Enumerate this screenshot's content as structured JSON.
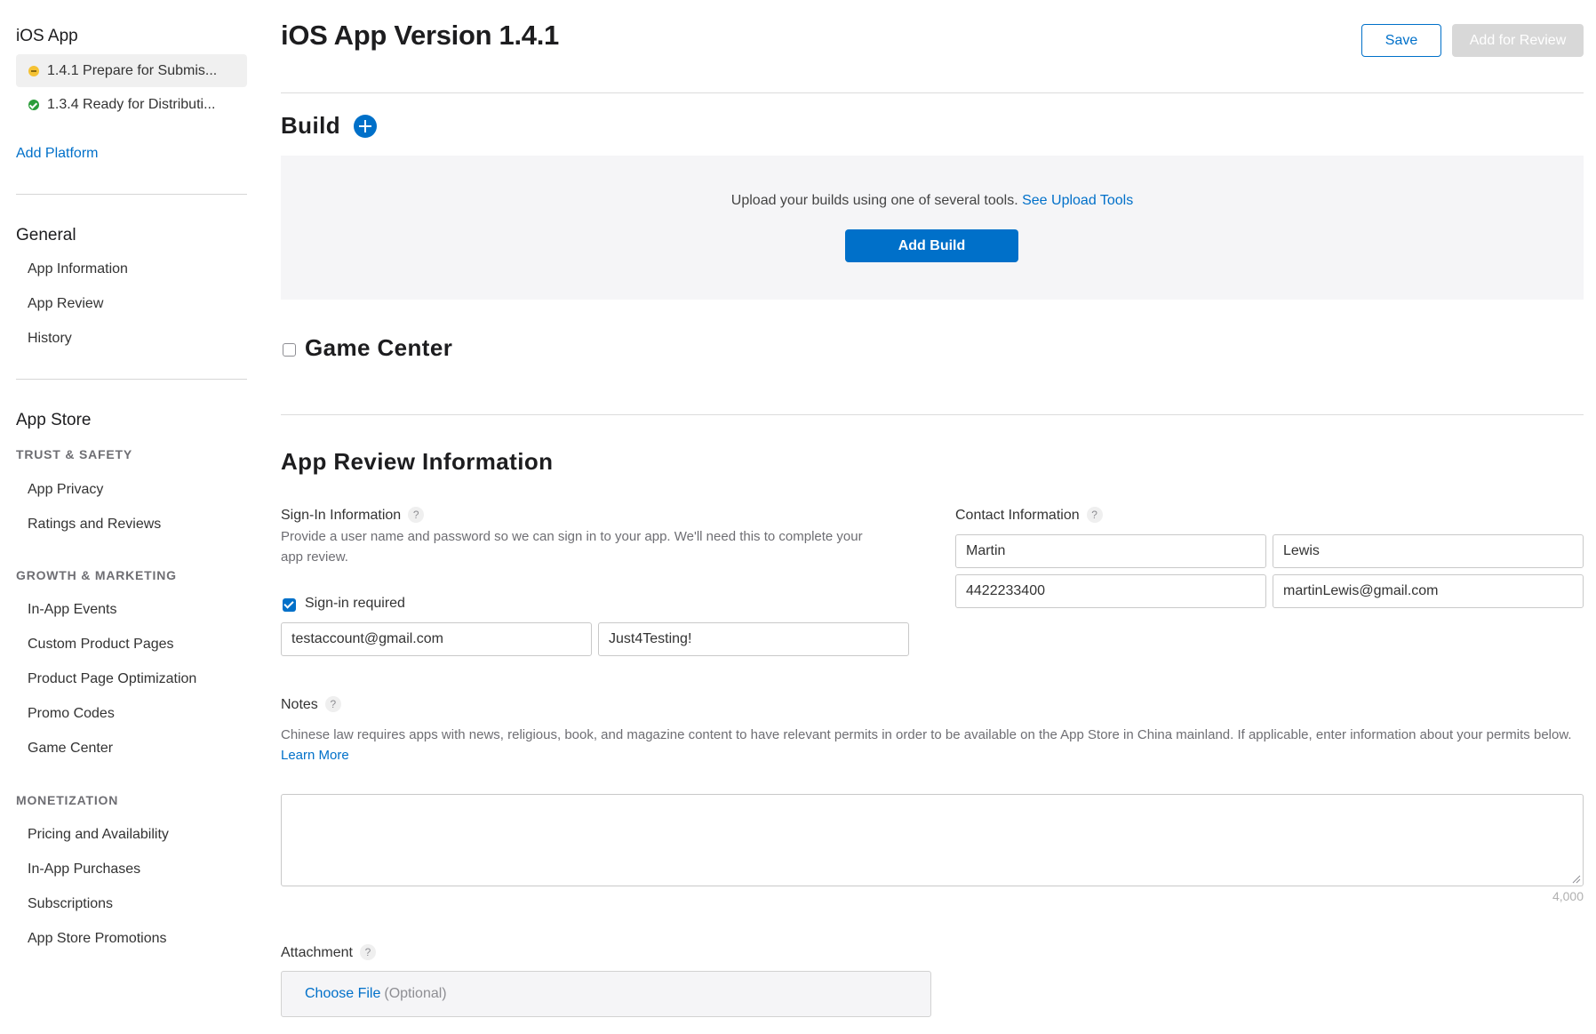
{
  "sidebar": {
    "app_title": "iOS App",
    "versions": [
      {
        "label": "1.4.1 Prepare for Submis...",
        "status": "yellow"
      },
      {
        "label": "1.3.4 Ready for Distributi...",
        "status": "green"
      }
    ],
    "add_platform": "Add Platform",
    "general": {
      "heading": "General",
      "items": [
        "App Information",
        "App Review",
        "History"
      ]
    },
    "app_store": {
      "heading": "App Store",
      "trust_safety": {
        "heading": "TRUST & SAFETY",
        "items": [
          "App Privacy",
          "Ratings and Reviews"
        ]
      },
      "growth_marketing": {
        "heading": "GROWTH & MARKETING",
        "items": [
          "In-App Events",
          "Custom Product Pages",
          "Product Page Optimization",
          "Promo Codes",
          "Game Center"
        ]
      },
      "monetization": {
        "heading": "MONETIZATION",
        "items": [
          "Pricing and Availability",
          "In-App Purchases",
          "Subscriptions",
          "App Store Promotions"
        ]
      }
    }
  },
  "header": {
    "title": "iOS App Version 1.4.1",
    "save_label": "Save",
    "add_for_review_label": "Add for Review"
  },
  "build": {
    "title": "Build",
    "upload_text": "Upload your builds using one of several tools.",
    "upload_link": "See Upload Tools",
    "add_build_label": "Add Build"
  },
  "game_center": {
    "title": "Game Center",
    "checked": false
  },
  "review_info": {
    "title": "App Review Information",
    "sign_in": {
      "label": "Sign-In Information",
      "description": "Provide a user name and password so we can sign in to your app. We'll need this to complete your app review.",
      "required_label": "Sign-in required",
      "required_checked": true,
      "username": "testaccount@gmail.com",
      "password": "Just4Testing!"
    },
    "contact": {
      "label": "Contact Information",
      "first_name": "Martin",
      "last_name": "Lewis",
      "phone": "4422233400",
      "email": "martinLewis@gmail.com"
    },
    "notes": {
      "label": "Notes",
      "description": "Chinese law requires apps with news, religious, book, and magazine content to have relevant permits in order to be available on the App Store in China mainland. If applicable, enter information about your permits below.",
      "learn_more": "Learn More",
      "value": "",
      "char_limit": "4,000"
    },
    "attachment": {
      "label": "Attachment",
      "choose_file": "Choose File",
      "optional": "(Optional)"
    },
    "help_glyph": "?"
  },
  "colors": {
    "accent": "#0070c9",
    "status_yellow": "#f5c234",
    "status_green": "#2a9d3a",
    "disabled_button": "#d8d8d8"
  }
}
